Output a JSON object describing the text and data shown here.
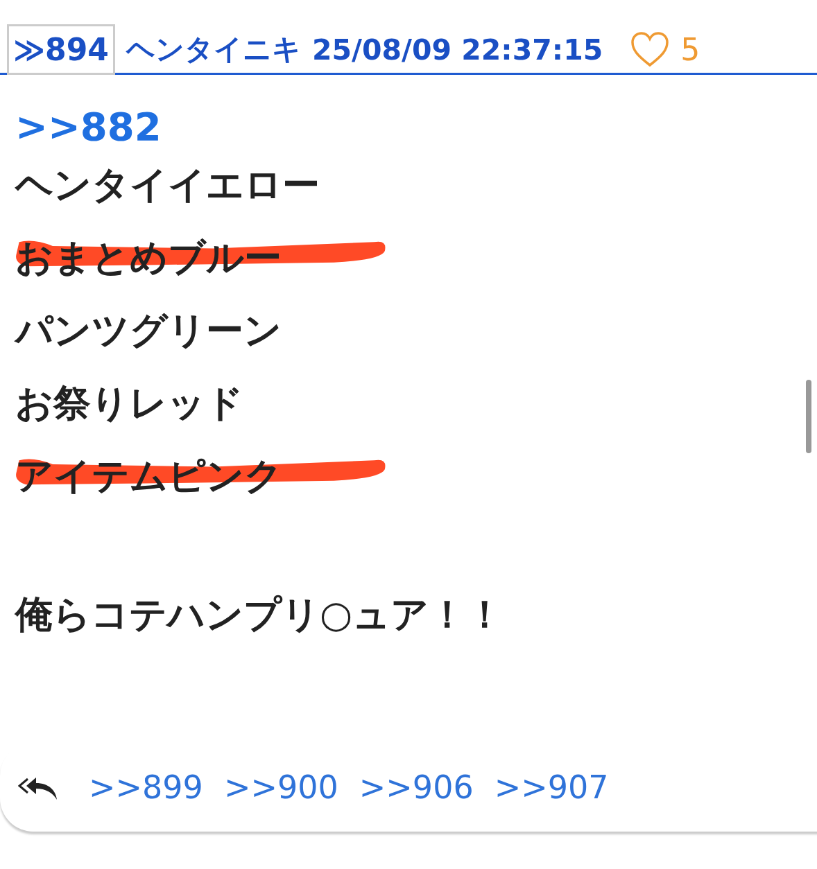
{
  "post": {
    "number": "≫894",
    "name": "ヘンタイニキ",
    "date": "25/08/09 22:37:15",
    "likes": "5",
    "liked": false
  },
  "quote": ">>882",
  "body": [
    {
      "text": "ヘンタイイエロー",
      "marked": false
    },
    {
      "text": "おまとめブルー",
      "marked": true
    },
    {
      "text": "パンツグリーン",
      "marked": false
    },
    {
      "text": "お祭りレッド",
      "marked": false
    },
    {
      "text": "アイテムピンク",
      "marked": true
    }
  ],
  "closing": "俺らコテハンプリ○ュア！！",
  "replies": [
    ">>899",
    ">>900",
    ">>906",
    ">>907"
  ]
}
